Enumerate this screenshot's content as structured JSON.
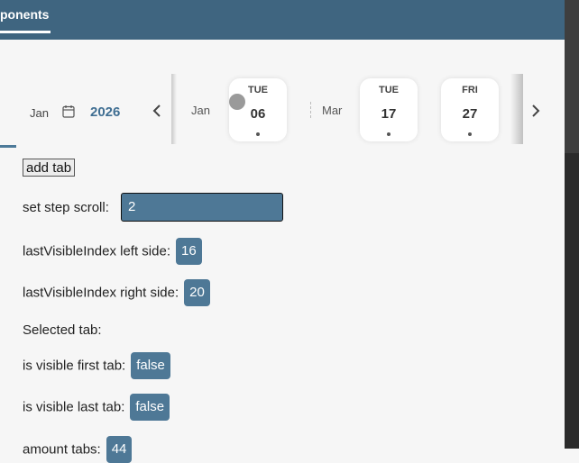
{
  "header": {
    "active_tab_label": "ponents"
  },
  "year_picker": {
    "month": "Jan",
    "year": "2026"
  },
  "date_strip": {
    "months": [
      "Jan",
      "Mar"
    ],
    "days": [
      {
        "dow": "TUE",
        "num": "06"
      },
      {
        "dow": "TUE",
        "num": "17"
      },
      {
        "dow": "FRI",
        "num": "27"
      }
    ]
  },
  "controls": {
    "add_tab_label": "add tab",
    "step_scroll_label": "set step scroll:",
    "step_scroll_value": "2",
    "last_left_label": "lastVisibleIndex left side:",
    "last_left_value": "16",
    "last_right_label": "lastVisibleIndex right side:",
    "last_right_value": "20",
    "selected_tab_label": "Selected tab:",
    "visible_first_label": "is visible first tab:",
    "visible_first_value": "false",
    "visible_last_label": "is visible last tab:",
    "visible_last_value": "false",
    "amount_tabs_label": "amount tabs:",
    "amount_tabs_value": "44"
  },
  "colors": {
    "header_bg": "#3f6580",
    "accent": "#4e7896"
  }
}
